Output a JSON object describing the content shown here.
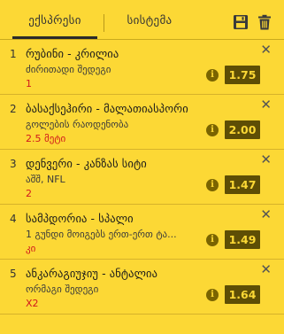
{
  "tabs": [
    {
      "label": "ექსპრესი",
      "active": true
    },
    {
      "label": "სისტემა",
      "active": false
    }
  ],
  "toolbar": {
    "save_icon": "save-icon",
    "trash_icon": "trash-icon"
  },
  "colors": {
    "panel_bg": "#fcd835",
    "odds_bg": "#5e4e05",
    "odds_text": "#fcd835",
    "pick_text": "#d1181c"
  },
  "bets": [
    {
      "index": "1",
      "teams": "რუბინი - კრილია",
      "market": "ძირითადი შედეგი",
      "pick": "1",
      "odds": "1.75"
    },
    {
      "index": "2",
      "teams": "ბასაქსეჰირი - მალათიასპორი",
      "market": "გოლების რაოდენობა",
      "pick": "2.5 მეტი",
      "odds": "2.00"
    },
    {
      "index": "3",
      "teams": "დენვერი - კანზას სიტი",
      "market": "აშშ, NFL",
      "pick": "2",
      "odds": "1.47"
    },
    {
      "index": "4",
      "teams": "სამპდორია - სპალი",
      "market": "1 გუნდი მოიგებს ერთ-ერთ ტა...",
      "pick": "კი",
      "odds": "1.49"
    },
    {
      "index": "5",
      "teams": "ანკარაგიუჯიუ - ანტალია",
      "market": "ორმაგი შედეგი",
      "pick": "X2",
      "odds": "1.64"
    }
  ],
  "close_symbol": "✕",
  "info_symbol": "i"
}
